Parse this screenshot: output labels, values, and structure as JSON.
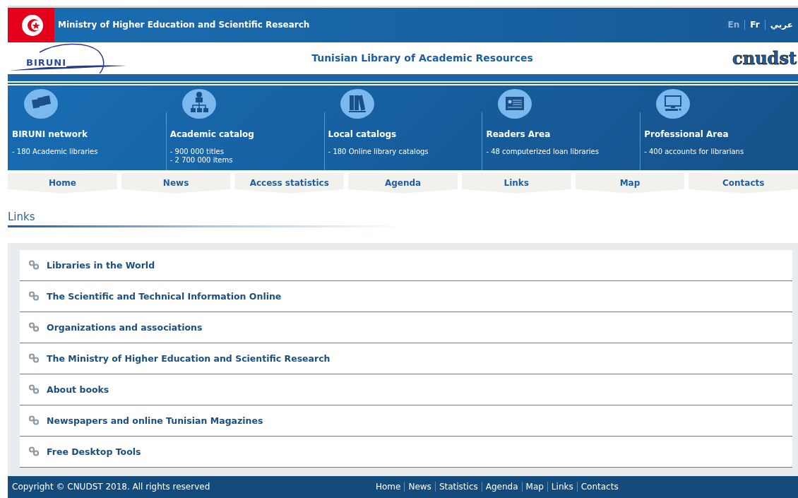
{
  "header": {
    "ministry": "Ministry of Higher Education and Scientific Research",
    "languages": [
      {
        "label": "En",
        "selected": true
      },
      {
        "label": "Fr",
        "selected": false
      },
      {
        "label": "عربي",
        "selected": false
      }
    ]
  },
  "banner": {
    "title": "Tunisian Library of Academic Resources",
    "logo_left": "BIRUNI",
    "logo_right": "cnudst"
  },
  "features": [
    {
      "kind": "pages",
      "title": "BIRUNI network",
      "lines": [
        "- 180 Academic libraries"
      ]
    },
    {
      "kind": "hierarchy",
      "title": "Academic catalog",
      "lines": [
        "- 900 000 titles",
        "- 2 700 000 items"
      ]
    },
    {
      "kind": "binders",
      "title": "Local catalogs",
      "lines": [
        "- 180 Online library catalogs"
      ]
    },
    {
      "kind": "card",
      "title": "Readers Area",
      "lines": [
        "- 48 computerized loan libraries"
      ]
    },
    {
      "kind": "computer",
      "title": "Professional Area",
      "lines": [
        "- 400 accounts for librarians"
      ]
    }
  ],
  "nav": [
    "Home",
    "News",
    "Access statistics",
    "Agenda",
    "Links",
    "Map",
    "Contacts"
  ],
  "page_title": "Links",
  "links": [
    "Libraries in the World",
    "The Scientific and Technical Information Online",
    "Organizations and associations",
    "The Ministry of Higher Education and Scientific Research",
    "About books",
    "Newspapers and online Tunisian Magazines",
    "Free Desktop Tools"
  ],
  "footer": {
    "copyright": "Copyright © CNUDST 2018. All rights reserved",
    "links": [
      "Home",
      "News",
      "Statistics",
      "Agenda",
      "Map",
      "Links",
      "Contacts"
    ]
  }
}
